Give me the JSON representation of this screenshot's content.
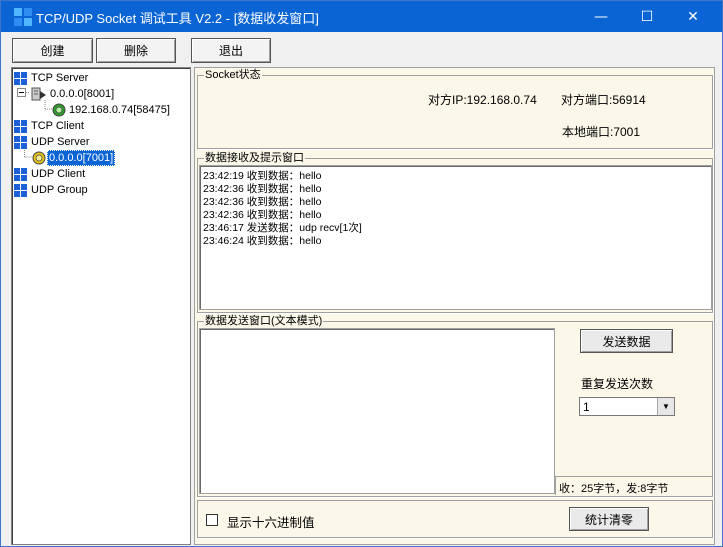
{
  "window": {
    "title": "TCP/UDP Socket 调试工具 V2.2 - [数据收发窗口]",
    "minimize_glyph": "—",
    "maximize_glyph": "☐",
    "close_glyph": "✕"
  },
  "toolbar": {
    "create_label": "创建",
    "delete_label": "删除",
    "exit_label": "退出"
  },
  "tree": {
    "tcp_server": "TCP Server",
    "tcp_server_child": "0.0.0.0[8001]",
    "tcp_server_conn": "192.168.0.74[58475]",
    "tcp_client": "TCP Client",
    "udp_server": "UDP Server",
    "udp_server_child": "0.0.0.0[7001]",
    "udp_client": "UDP Client",
    "udp_group": "UDP Group"
  },
  "socket_status": {
    "legend": "Socket状态",
    "remote_ip": "对方IP:192.168.0.74",
    "remote_port": "对方端口:56914",
    "local_port": "本地端口:7001"
  },
  "receive": {
    "legend": "数据接收及提示窗口",
    "lines": [
      "23:42:19 收到数据：hello",
      "23:42:36 收到数据：hello",
      "23:42:36 收到数据：hello",
      "23:42:36 收到数据：hello",
      "23:46:17 发送数据：udp recv[1次]",
      "23:46:24 收到数据：hello"
    ]
  },
  "send": {
    "legend": "数据发送窗口(文本模式)",
    "send_button": "发送数据",
    "repeat_label": "重复发送次数",
    "repeat_value": "1",
    "counter": "收：25字节，发:8字节"
  },
  "bottom": {
    "hex_label": "显示十六进制值",
    "reset_button": "统计清零"
  },
  "colors": {
    "titlebar": "#0a64d3",
    "status_bg": "#fbf8e9",
    "tree_icon_blue": "#1d5fd6",
    "socket_green": "#2e9d2e"
  }
}
